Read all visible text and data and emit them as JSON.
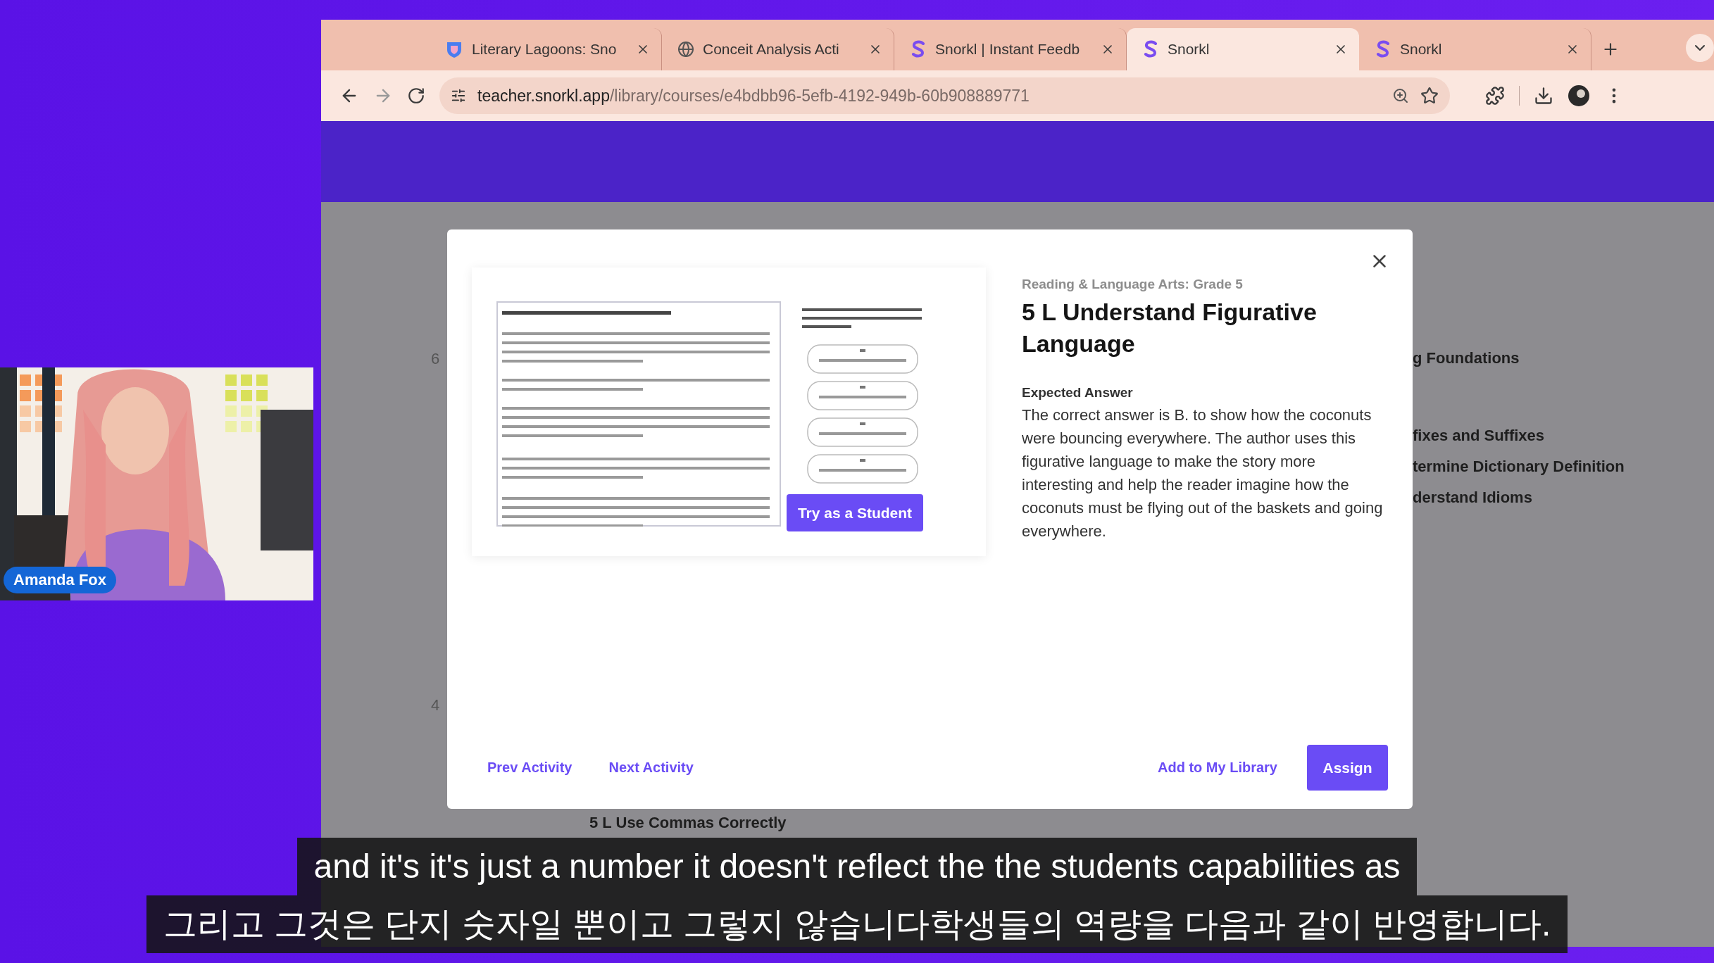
{
  "browser": {
    "tabs": [
      {
        "title": "Literary Lagoons: Sno",
        "kind": "shield",
        "selected": false
      },
      {
        "title": "Conceit Analysis Acti",
        "kind": "globe",
        "selected": false
      },
      {
        "title": "Snorkl | Instant Feedb",
        "kind": "snorkl",
        "selected": false
      },
      {
        "title": "Snorkl",
        "kind": "snorkl",
        "selected": true
      },
      {
        "title": "Snorkl",
        "kind": "snorkl",
        "selected": false
      }
    ],
    "url": {
      "host": "teacher.snorkl.app",
      "path": "/library/courses/e4bdbb96-5efb-4192-949b-60b908889771"
    }
  },
  "page_background": {
    "left_numbers": [
      "6",
      "4"
    ],
    "right_groups": [
      [
        "g Foundations"
      ],
      [
        "fixes and Suffixes",
        "termine Dictionary Definition",
        "derstand Idioms"
      ]
    ],
    "lower_items": [
      "5 L Use Commas Correctly"
    ]
  },
  "modal": {
    "course": "Reading & Language Arts: Grade 5",
    "title": "5 L Understand Figurative Language",
    "answer_heading": "Expected Answer",
    "answer": "The  correct answer is B. to show how the coconuts were bouncing everywhere. The author uses this figurative language to make the story more interesting and help the reader imagine how the coconuts must be flying out of the baskets and going everywhere.",
    "preview_button": "Try as a Student",
    "footer": {
      "navigation": [
        "Prev Activity",
        "Next Activity"
      ],
      "library_link": "Add to My Library",
      "assign": "Assign"
    }
  },
  "webcam": {
    "kind": "picture",
    "name": "Amanda Fox"
  },
  "subtitles": [
    "and it's it's just a number it doesn't reflect the the students capabilities as",
    "그리고 그것은 단지 숫자일 뿐이고 그렇지 않습니다학생들의 역량을 다음과 같이 반영합니다."
  ]
}
